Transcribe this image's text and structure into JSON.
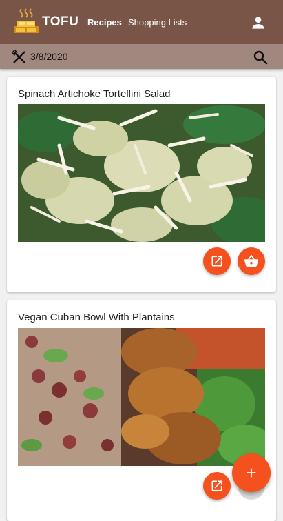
{
  "app": {
    "brand": "TOFU"
  },
  "nav": {
    "recipes_label": "Recipes",
    "shopping_lists_label": "Shopping Lists"
  },
  "toolbar": {
    "date": "3/8/2020"
  },
  "recipes": [
    {
      "title": "Spinach Artichoke Tortellini Salad"
    },
    {
      "title": "Vegan Cuban Bowl With Plantains"
    }
  ],
  "icons": {
    "logo": "tofu-logo-icon",
    "account": "account-icon",
    "cutlery": "cutlery-icon",
    "search": "search-icon",
    "open": "open-in-new-icon",
    "basket": "basket-icon",
    "add": "add-icon"
  },
  "colors": {
    "appbar": "#795548",
    "subbar": "#a1887f",
    "accent": "#f4511e",
    "background": "#f1f1f1"
  }
}
